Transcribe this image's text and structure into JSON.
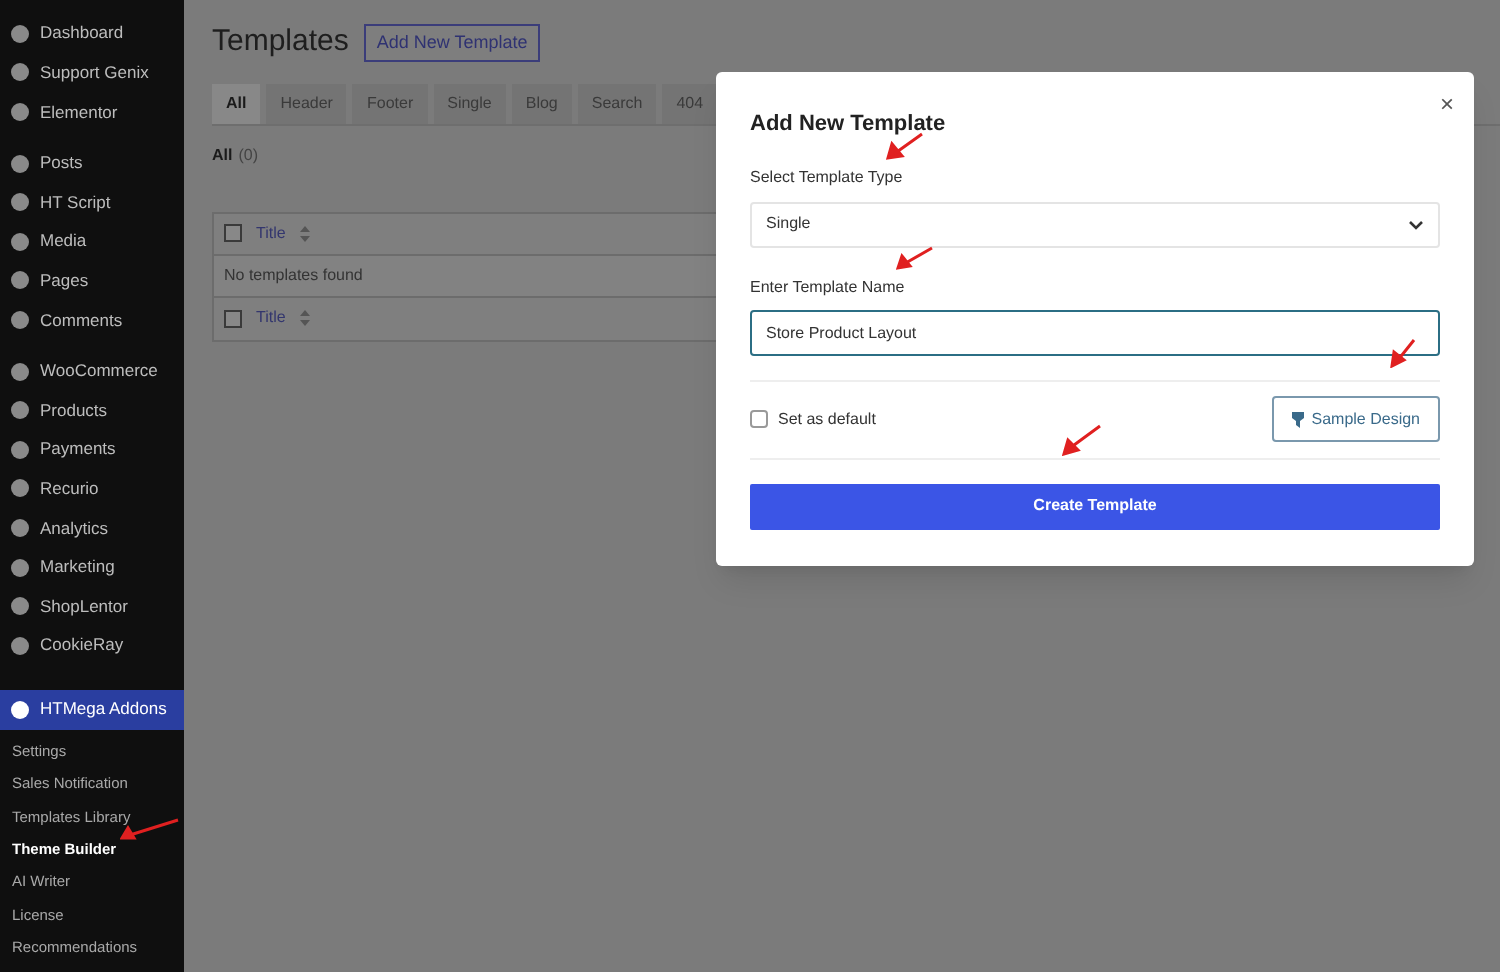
{
  "sidebar": {
    "groups": [
      {
        "items": [
          {
            "label": "Dashboard",
            "selected": false
          },
          {
            "label": "Support Genix",
            "selected": false
          },
          {
            "label": "Elementor",
            "selected": false
          }
        ]
      },
      {
        "items": [
          {
            "label": "Posts",
            "selected": false
          },
          {
            "label": "HT Script",
            "selected": false
          },
          {
            "label": "Media",
            "selected": false
          },
          {
            "label": "Pages",
            "selected": false
          },
          {
            "label": "Comments",
            "selected": false
          }
        ]
      },
      {
        "items": [
          {
            "label": "WooCommerce",
            "selected": false
          },
          {
            "label": "Products",
            "selected": false
          },
          {
            "label": "Payments",
            "selected": false
          },
          {
            "label": "Recurio",
            "selected": false
          },
          {
            "label": "Analytics",
            "selected": false
          },
          {
            "label": "Marketing",
            "selected": false
          },
          {
            "label": "ShopLentor",
            "selected": false
          },
          {
            "label": "CookieRay",
            "selected": false
          }
        ]
      },
      {
        "items": [
          {
            "label": "HTMega Addons",
            "selected": true
          }
        ]
      }
    ],
    "submenu": [
      {
        "label": "Settings",
        "selected": false
      },
      {
        "label": "Sales Notification",
        "selected": false
      },
      {
        "label": "Templates Library",
        "selected": false
      },
      {
        "label": "Theme Builder",
        "selected": true
      },
      {
        "label": "AI Writer",
        "selected": false
      },
      {
        "label": "License",
        "selected": false
      },
      {
        "label": "Recommendations",
        "selected": false
      }
    ]
  },
  "page": {
    "title": "Templates",
    "add_button": "Add New Template",
    "tabs": [
      {
        "label": "All",
        "selected": true
      },
      {
        "label": "Header",
        "selected": false
      },
      {
        "label": "Footer",
        "selected": false
      },
      {
        "label": "Single",
        "selected": false
      },
      {
        "label": "Blog",
        "selected": false
      },
      {
        "label": "Search",
        "selected": false
      },
      {
        "label": "404",
        "selected": false
      }
    ],
    "filter": {
      "label": "All",
      "count": "(0)"
    },
    "table": {
      "header_checked": false,
      "footer_checked": false,
      "header": "Title",
      "empty_message": "No templates found",
      "footer": "Title"
    }
  },
  "modal": {
    "title": "Add New Template",
    "close": "×",
    "type_label": "Select Template Type",
    "type_value": "Single",
    "name_label": "Enter Template Name",
    "name_value": "Store Product Layout",
    "default_label": "Set as default",
    "default_checked": false,
    "sample_button": "Sample Design",
    "create_button": "Create Template"
  }
}
